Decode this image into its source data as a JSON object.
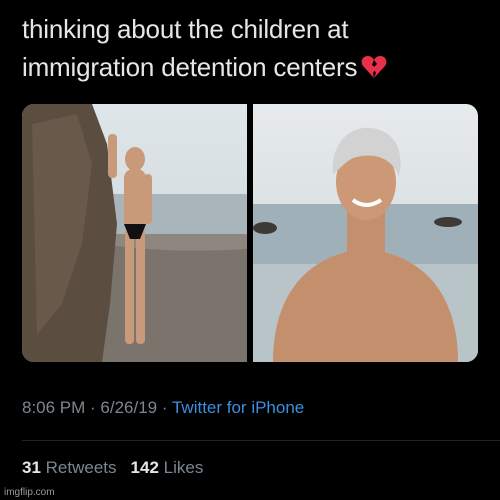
{
  "tweet": {
    "text_line1": "thinking about the children at",
    "text_line2": "immigration detention centers",
    "emoji": "broken-heart-icon"
  },
  "media": {
    "photos": [
      "beach-photo-rock",
      "beach-photo-closeup"
    ]
  },
  "meta": {
    "time": "8:06 PM",
    "separator1": " · ",
    "date": "6/26/19",
    "separator2": " · ",
    "source": "Twitter for iPhone"
  },
  "stats": {
    "retweets_count": "31",
    "retweets_label": "Retweets",
    "likes_count": "142",
    "likes_label": "Likes"
  },
  "watermark": "imgflip.com",
  "colors": {
    "background": "#000000",
    "text": "#e6e6e6",
    "muted": "#7d8690",
    "link": "#3a8fe0",
    "heart": "#e8304a"
  }
}
